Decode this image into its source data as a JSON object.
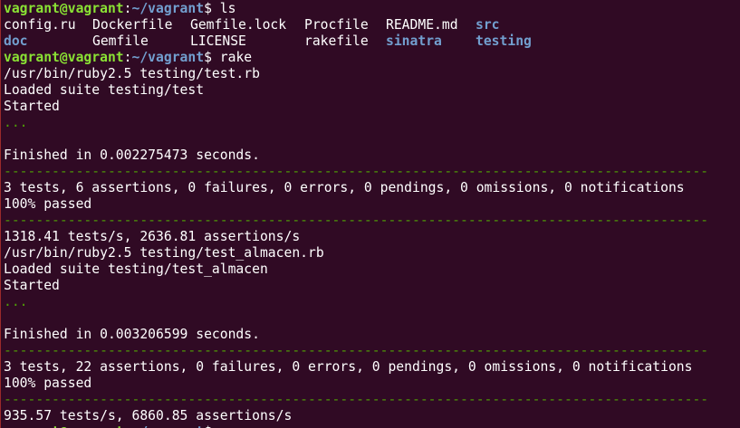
{
  "prompt": {
    "user_host": "vagrant@vagrant",
    "separator": ":",
    "path": "~/vagrant",
    "dollar": "$ "
  },
  "cmd_ls": "ls",
  "ls_row1": [
    "config.ru",
    "Dockerfile",
    "Gemfile.lock",
    "Procfile",
    "README.md",
    "src"
  ],
  "ls_row2": [
    "doc",
    "Gemfile",
    "LICENSE",
    "rakefile",
    "sinatra",
    "testing"
  ],
  "cmd_rake": "rake",
  "run1": {
    "cmd": "/usr/bin/ruby2.5 testing/test.rb",
    "loaded": "Loaded suite testing/test",
    "started": "Started",
    "dots": "...",
    "finished": "Finished in 0.002275473 seconds.",
    "separator": "----------------------------------------------------------------------------------------",
    "summary": "3 tests, 6 assertions, 0 failures, 0 errors, 0 pendings, 0 omissions, 0 notifications",
    "passed": "100% passed",
    "rate": "1318.41 tests/s, 2636.81 assertions/s"
  },
  "run2": {
    "cmd": "/usr/bin/ruby2.5 testing/test_almacen.rb",
    "loaded": "Loaded suite testing/test_almacen",
    "started": "Started",
    "dots": "...",
    "finished": "Finished in 0.003206599 seconds.",
    "separator": "----------------------------------------------------------------------------------------",
    "summary": "3 tests, 22 assertions, 0 failures, 0 errors, 0 pendings, 0 omissions, 0 notifications",
    "passed": "100% passed",
    "rate": "935.57 tests/s, 6860.85 assertions/s"
  },
  "colors": {
    "background": "#300a24",
    "prompt_user": "#8ae234",
    "prompt_path": "#729fcf",
    "directory": "#729fcf",
    "separator_green": "#4e9a06",
    "text": "#ffffff"
  }
}
